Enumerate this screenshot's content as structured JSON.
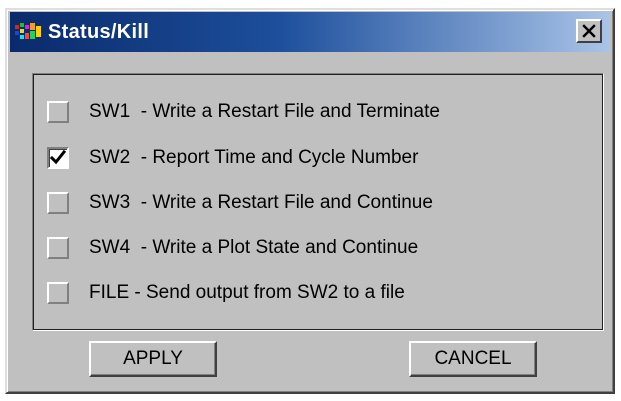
{
  "window": {
    "title": "Status/Kill",
    "close_label": "X"
  },
  "options": [
    {
      "label": "SW1  - Write a Restart File and Terminate",
      "checked": false
    },
    {
      "label": "SW2  - Report Time and Cycle Number",
      "checked": true
    },
    {
      "label": "SW3  - Write a Restart File and Continue",
      "checked": false
    },
    {
      "label": "SW4  - Write a Plot State and Continue",
      "checked": false
    },
    {
      "label": "FILE - Send output from SW2 to a file",
      "checked": false
    }
  ],
  "buttons": {
    "apply_label": "APPLY",
    "cancel_label": "CANCEL"
  },
  "colors": {
    "titlebar_start": "#0a2a6b",
    "titlebar_end": "#a9c4e8",
    "face": "#c0c0c0"
  }
}
